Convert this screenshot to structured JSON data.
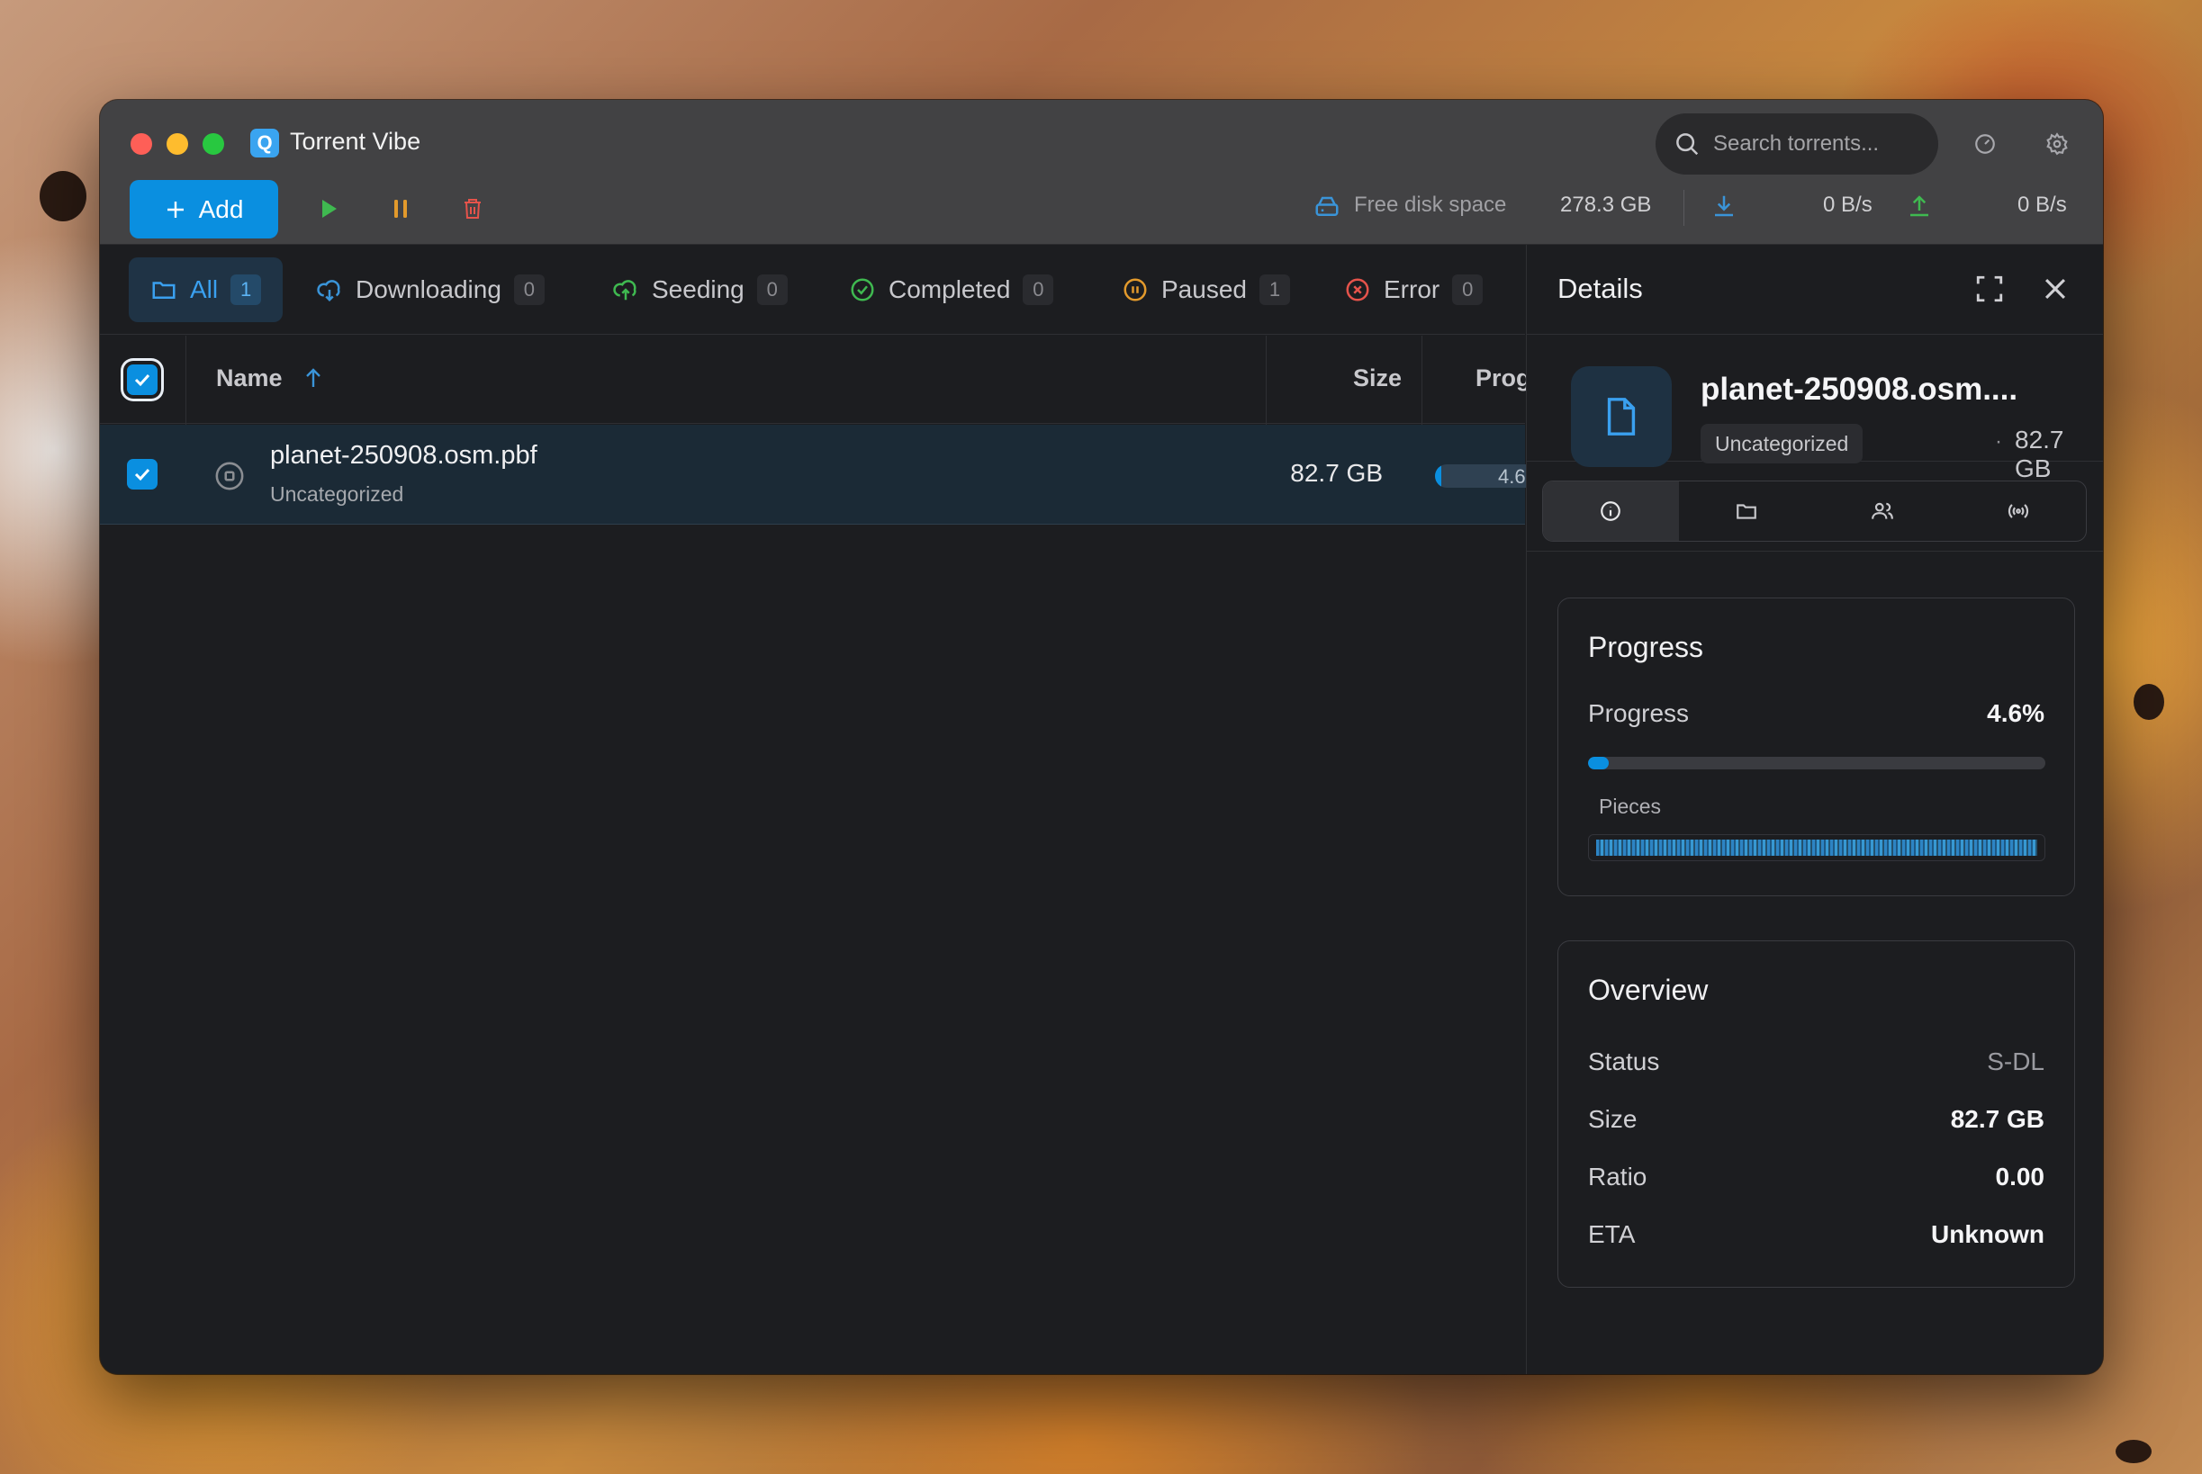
{
  "app": {
    "title": "Torrent Vibe",
    "icon_letter": "Q"
  },
  "search": {
    "placeholder": "Search torrents..."
  },
  "toolbar": {
    "add_label": "Add",
    "disk_label": "Free disk space",
    "disk_value": "278.3 GB",
    "download_speed": "0 B/s",
    "upload_speed": "0 B/s"
  },
  "tabs": [
    {
      "label": "All",
      "count": "1",
      "icon": "folder-icon"
    },
    {
      "label": "Downloading",
      "count": "0",
      "icon": "cloud-download-icon"
    },
    {
      "label": "Seeding",
      "count": "0",
      "icon": "cloud-upload-icon"
    },
    {
      "label": "Completed",
      "count": "0",
      "icon": "check-circle-icon"
    },
    {
      "label": "Paused",
      "count": "1",
      "icon": "pause-circle-icon"
    },
    {
      "label": "Error",
      "count": "0",
      "icon": "x-circle-icon"
    }
  ],
  "table": {
    "columns": {
      "name": "Name",
      "size": "Size",
      "progress": "Prog"
    },
    "rows": [
      {
        "name": "planet-250908.osm.pbf",
        "category": "Uncategorized",
        "size": "82.7 GB",
        "progress_label": "4.6",
        "progress_fraction": 0.046
      }
    ]
  },
  "details": {
    "title": "Details",
    "file_name": "planet-250908.osm....",
    "category": "Uncategorized",
    "separator": "·",
    "size": "82.7 GB",
    "progress_card": {
      "title": "Progress",
      "label": "Progress",
      "value": "4.6%",
      "fraction": 0.046,
      "pieces_label": "Pieces"
    },
    "overview": {
      "title": "Overview",
      "rows": [
        {
          "label": "Status",
          "value": "S-DL"
        },
        {
          "label": "Size",
          "value": "82.7 GB"
        },
        {
          "label": "Ratio",
          "value": "0.00"
        },
        {
          "label": "ETA",
          "value": "Unknown"
        }
      ]
    }
  },
  "colors": {
    "accent": "#0a8fe0",
    "play": "#3fb950",
    "pause": "#e39a2c",
    "delete": "#e5534b"
  }
}
